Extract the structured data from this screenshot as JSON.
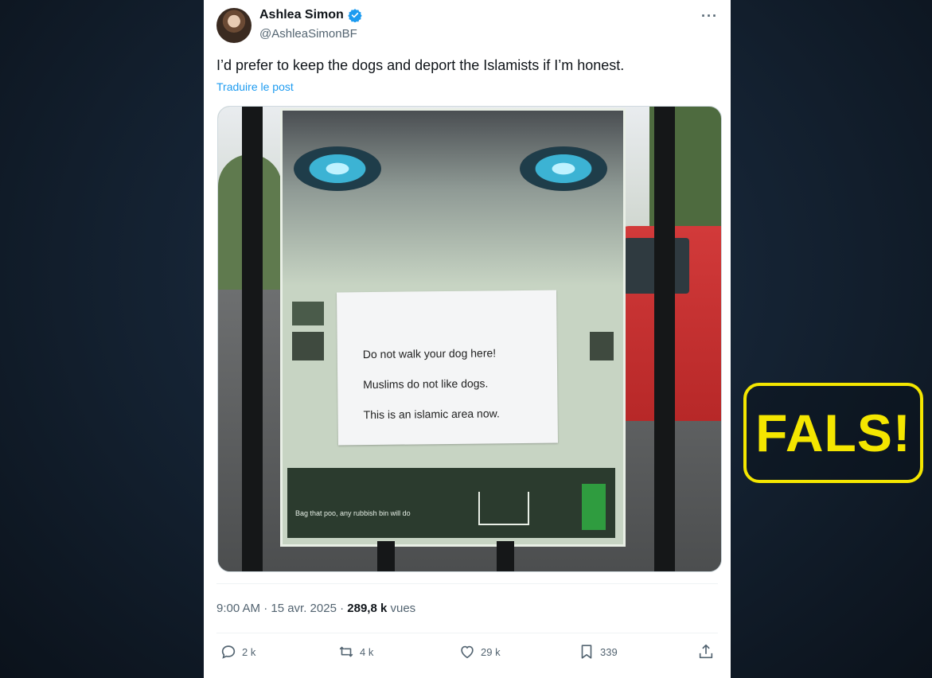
{
  "tweet": {
    "author_name": "Ashlea Simon",
    "author_handle": "@AshleaSimonBF",
    "text": "I’d prefer to keep the dogs and deport the Islamists if I’m honest.",
    "translate_label": "Traduire le post",
    "timestamp": "9:00 AM · 15 avr. 2025 · ",
    "views_value": "289,8 k",
    "views_label": " vues",
    "more_label": "···"
  },
  "photo": {
    "note_lines": [
      "Do not walk your dog here!",
      "Muslims do not like dogs.",
      "This is an islamic area now."
    ],
    "poster_bottom_text": "Bag that poo, any rubbish bin will do"
  },
  "actions": {
    "replies": "2 k",
    "reposts": "4 k",
    "likes": "29 k",
    "bookmarks": "339"
  },
  "overlay": {
    "verdict": "FALS!",
    "verdict_color": "#f4e600"
  },
  "colors": {
    "accent_link": "#1d9bf0",
    "secondary_text": "#536471"
  }
}
